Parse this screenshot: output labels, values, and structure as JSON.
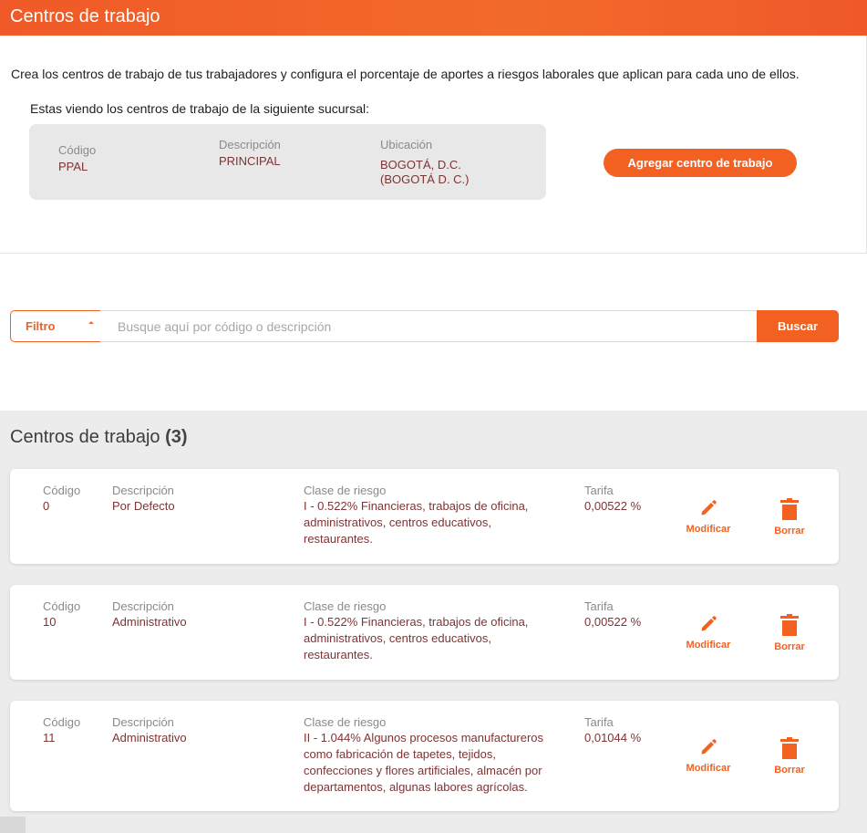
{
  "header": {
    "title": "Centros de trabajo"
  },
  "intro": {
    "text": "Crea los centros de trabajo de tus trabajadores y configura el porcentaje de aportes a riesgos laborales que aplican para cada uno de ellos."
  },
  "branch": {
    "viewing_text": "Estas viendo los centros de trabajo de la siguiente sucursal:",
    "codigo_label": "Código",
    "codigo_value": "PPAL",
    "descripcion_label": "Descripción",
    "descripcion_value": "PRINCIPAL",
    "ubicacion_label": "Ubicación",
    "ubicacion_line1": "BOGOTÁ, D.C.",
    "ubicacion_line2": "(BOGOTÁ D. C.)"
  },
  "add_button": {
    "label": "Agregar centro de trabajo"
  },
  "search": {
    "filter_label": "Filtro",
    "placeholder": "Busque aquí por código o descripción",
    "value": "",
    "button_label": "Buscar"
  },
  "list": {
    "title": "Centros de trabajo",
    "count": "(3)",
    "labels": {
      "codigo": "Código",
      "descripcion": "Descripción",
      "clase": "Clase de riesgo",
      "tarifa": "Tarifa",
      "modificar": "Modificar",
      "borrar": "Borrar"
    },
    "items": [
      {
        "codigo": "0",
        "descripcion": "Por Defecto",
        "clase_lines": [
          "I - 0.522% Financieras, trabajos de oficina,",
          "administrativos, centros educativos,",
          "restaurantes."
        ],
        "tarifa": "0,00522 %"
      },
      {
        "codigo": "10",
        "descripcion": "Administrativo",
        "clase_lines": [
          "I - 0.522% Financieras, trabajos de oficina,",
          "administrativos, centros educativos,",
          "restaurantes."
        ],
        "tarifa": "0,00522 %"
      },
      {
        "codigo": "11",
        "descripcion": "Administrativo",
        "clase_lines": [
          "II - 1.044% Algunos procesos manufactureros",
          "como fabricación de tapetes, tejidos,",
          "confecciones y flores artificiales, almacén por",
          "departamentos, algunas labores agrícolas."
        ],
        "tarifa": "0,01044 %"
      }
    ]
  },
  "colors": {
    "accent": "#f26122",
    "value_text": "#7d3434",
    "label_text": "#8a8a8a",
    "list_background": "#ececec"
  },
  "icons": {
    "edit": "pencil-icon",
    "delete": "trash-icon",
    "filter_caret": "caret-icon"
  }
}
